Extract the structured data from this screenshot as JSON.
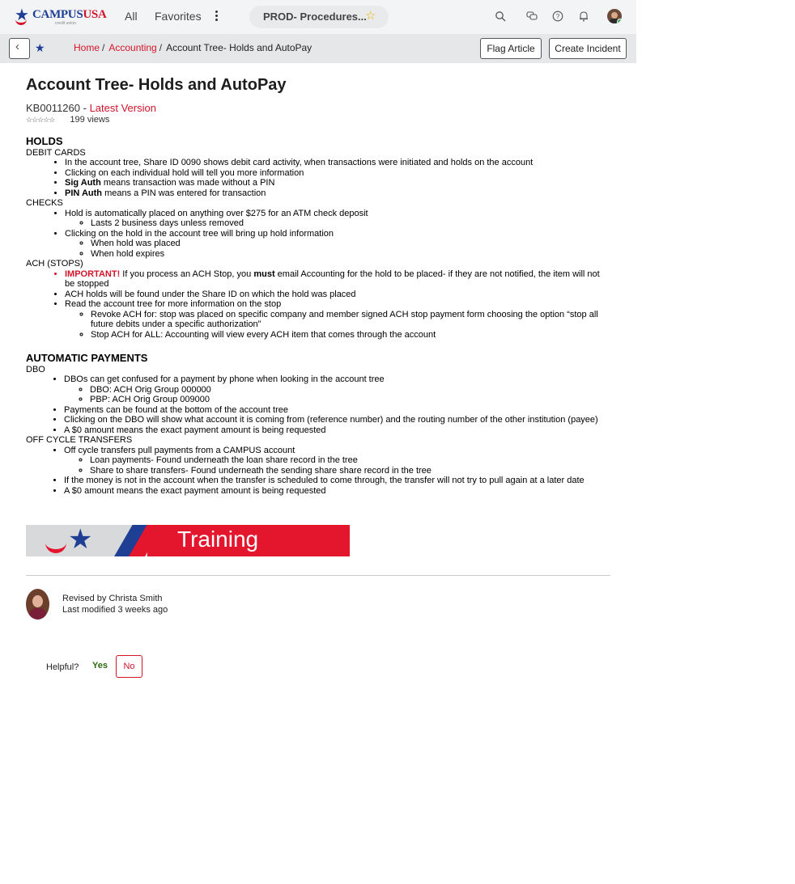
{
  "header": {
    "logo": {
      "brand": "CAMPUS",
      "brand2": "USA",
      "tagline": "credit union"
    },
    "nav": {
      "all": "All",
      "favorites": "Favorites"
    },
    "context_pill": "PROD- Procedures...",
    "icons": [
      "search-icon",
      "chat-icon",
      "help-icon",
      "bell-icon"
    ]
  },
  "subbar": {
    "breadcrumb": {
      "home": "Home",
      "accounting": "Accounting",
      "current": "Account Tree- Holds and AutoPay"
    },
    "flag_label": "Flag Article",
    "incident_label": "Create Incident"
  },
  "article": {
    "title": "Account Tree- Holds and AutoPay",
    "number": "KB0011260",
    "version": "Latest Version",
    "stars": "☆☆☆☆☆",
    "views": "199 views",
    "holds": {
      "heading": "HOLDS",
      "debit_title": "DEBIT CARDS",
      "debit": [
        {
          "b": "",
          "t": "In the account tree, Share ID 0090 shows debit card activity, when transactions were initiated and holds on the account"
        },
        {
          "b": "",
          "t": "Clicking on each individual hold will tell you more information"
        },
        {
          "b": "Sig Auth",
          "t": " means transaction was made without a PIN"
        },
        {
          "b": "PIN Auth",
          "t": " means a PIN was entered for transaction"
        }
      ],
      "checks_title": "CHECKS",
      "checks_1": "Hold is automatically placed on anything over $275 for an ATM check deposit",
      "checks_1_sub": "Lasts 2 business days unless removed",
      "checks_2": "Clicking on the hold in the account tree will bring up hold information",
      "checks_2_sub": [
        "When hold was placed",
        "When hold expires"
      ],
      "ach_title": "ACH (STOPS)",
      "ach_important": "IMPORTANT!",
      "ach_imp_a": " If you process an ACH Stop, you ",
      "ach_imp_must": "must",
      "ach_imp_b": " email Accounting for the hold to be placed- if they are not notified, the item will not be stopped",
      "ach_2": "ACH holds will be found under the Share ID on which the hold was placed",
      "ach_3": "Read the account tree for more information on the stop",
      "ach_3_sub": [
        "Revoke ACH for: stop was placed on specific company and member signed ACH stop payment form choosing the option “stop all future debits under a specific authorization”",
        "Stop ACH for ALL: Accounting will view every ACH item that comes through the account"
      ]
    },
    "autopay": {
      "heading": "AUTOMATIC PAYMENTS",
      "dbo_title": "DBO",
      "dbo_1": "DBOs can get confused for a payment by phone when looking in the account tree",
      "dbo_1_sub": [
        "DBO: ACH Orig Group 000000",
        "PBP: ACH Orig Group 009000"
      ],
      "dbo_rest": [
        "Payments can be found at the bottom of the account tree",
        "Clicking on the DBO will show what account it is coming from (reference number) and the routing number of the other institution (payee)",
        "A $0 amount means the exact payment amount is being requested"
      ],
      "oct_title": "OFF CYCLE TRANSFERS",
      "oct_1": "Off cycle transfers pull payments from a CAMPUS account",
      "oct_1_sub": [
        "Loan payments- Found underneath the loan share record in the tree",
        "Share to share transfers- Found underneath the sending share share record in the tree"
      ],
      "oct_rest": [
        "If the money is not in the account when the transfer is scheduled to come through, the transfer will not try to pull again at a later date",
        "A $0 amount means the exact payment amount is being requested"
      ]
    },
    "banner_text": "Training"
  },
  "footer": {
    "revised": "Revised by Christa Smith",
    "modified": "Last modified 3 weeks ago",
    "helpful_label": "Helpful?",
    "yes_label": "Yes",
    "no_label": "No"
  },
  "colors": {
    "brand_blue": "#1f3f95",
    "brand_red": "#d3142b"
  }
}
